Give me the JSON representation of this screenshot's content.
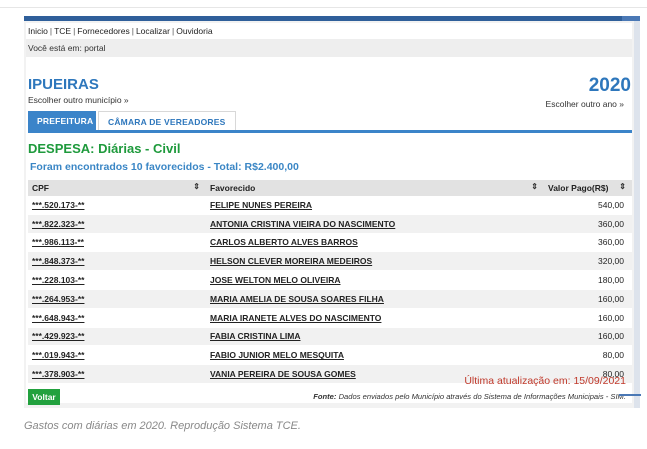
{
  "nav": {
    "links": [
      "Inicio",
      "TCE",
      "Fornecedores",
      "Localizar",
      "Ouvidoria"
    ],
    "separator": "|"
  },
  "breadcrumb": "Você está em: portal",
  "municipio": {
    "name": "IPUEIRAS",
    "change_label": "Escolher outro município »"
  },
  "ano": {
    "value": "2020",
    "change_label": "Escolher outro ano »"
  },
  "tabs": [
    {
      "label": "PREFEITURA",
      "active": true
    },
    {
      "label": "CÂMARA DE VEREADORES",
      "active": false
    }
  ],
  "despesa_title": "DESPESA: Diárias - Civil",
  "found_text": "Foram encontrados 10 favorecidos - Total: R$2.400,00",
  "table": {
    "headers": [
      "CPF",
      "Favorecido",
      "Valor Pago(R$)"
    ],
    "sort_icon": "⇕",
    "rows": [
      {
        "cpf": "***.520.173-**",
        "nome": "FELIPE NUNES PEREIRA",
        "valor": "540,00"
      },
      {
        "cpf": "***.822.323-**",
        "nome": "ANTONIA CRISTINA VIEIRA DO NASCIMENTO",
        "valor": "360,00"
      },
      {
        "cpf": "***.986.113-**",
        "nome": "CARLOS ALBERTO ALVES BARROS",
        "valor": "360,00"
      },
      {
        "cpf": "***.848.373-**",
        "nome": "HELSON CLEVER MOREIRA MEDEIROS",
        "valor": "320,00"
      },
      {
        "cpf": "***.228.103-**",
        "nome": "JOSE WELTON MELO OLIVEIRA",
        "valor": "180,00"
      },
      {
        "cpf": "***.264.953-**",
        "nome": "MARIA AMELIA DE SOUSA SOARES FILHA",
        "valor": "160,00"
      },
      {
        "cpf": "***.648.943-**",
        "nome": "MARIA IRANETE ALVES DO NASCIMENTO",
        "valor": "160,00"
      },
      {
        "cpf": "***.429.923-**",
        "nome": "FABIA CRISTINA LIMA",
        "valor": "160,00"
      },
      {
        "cpf": "***.019.943-**",
        "nome": "FABIO JUNIOR MELO MESQUITA",
        "valor": "80,00"
      },
      {
        "cpf": "***.378.903-**",
        "nome": "VANIA PEREIRA DE SOUSA GOMES",
        "valor": "80,00"
      }
    ]
  },
  "update_text": "Última atualização em: 15/09/2021",
  "voltar_label": "Voltar",
  "fonte": {
    "label": "Fonte:",
    "text": "Dados enviados pelo Município através do Sistema de Informações Municipais - SIM."
  },
  "caption": "Gastos com diárias em 2020. Reprodução Sistema TCE.",
  "colors": {
    "accent_blue": "#3b84c9",
    "title_green": "#1e9a3c",
    "update_red": "#c0392b"
  }
}
